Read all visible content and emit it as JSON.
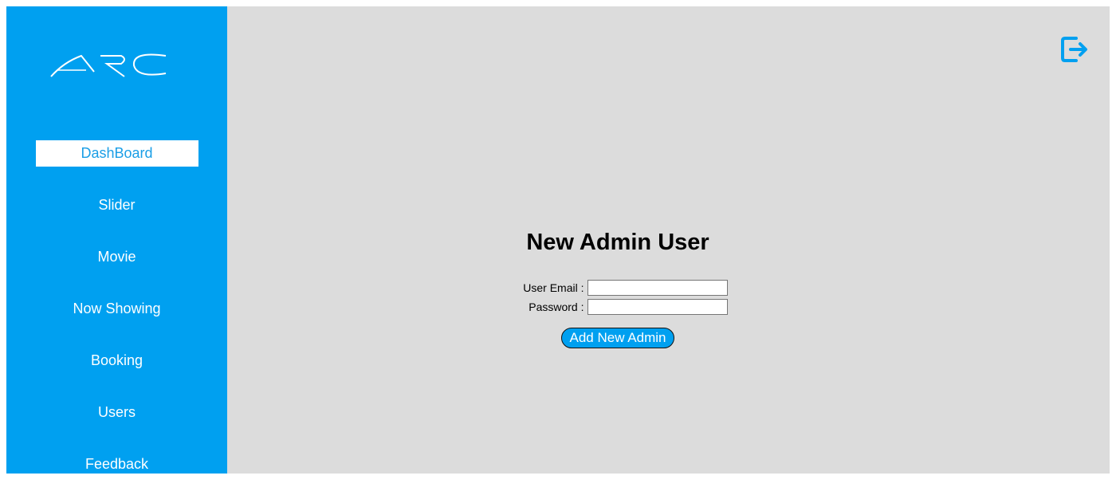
{
  "brand": {
    "logo_text": "ARC"
  },
  "sidebar": {
    "items": [
      {
        "label": "DashBoard",
        "active": true
      },
      {
        "label": "Slider",
        "active": false
      },
      {
        "label": "Movie",
        "active": false
      },
      {
        "label": "Now Showing",
        "active": false
      },
      {
        "label": "Booking",
        "active": false
      },
      {
        "label": "Users",
        "active": false
      },
      {
        "label": "Feedback",
        "active": false
      }
    ]
  },
  "header": {
    "logout_icon": "logout-icon"
  },
  "form": {
    "title": "New Admin User",
    "email_label": "User Email :",
    "email_value": "",
    "password_label": "Password :",
    "password_value": "",
    "submit_label": "Add New Admin"
  },
  "colors": {
    "sidebar_bg": "#00a0f0",
    "main_bg": "#dcdcdc",
    "active_text": "#1a9ee6",
    "accent": "#00a0f0"
  }
}
